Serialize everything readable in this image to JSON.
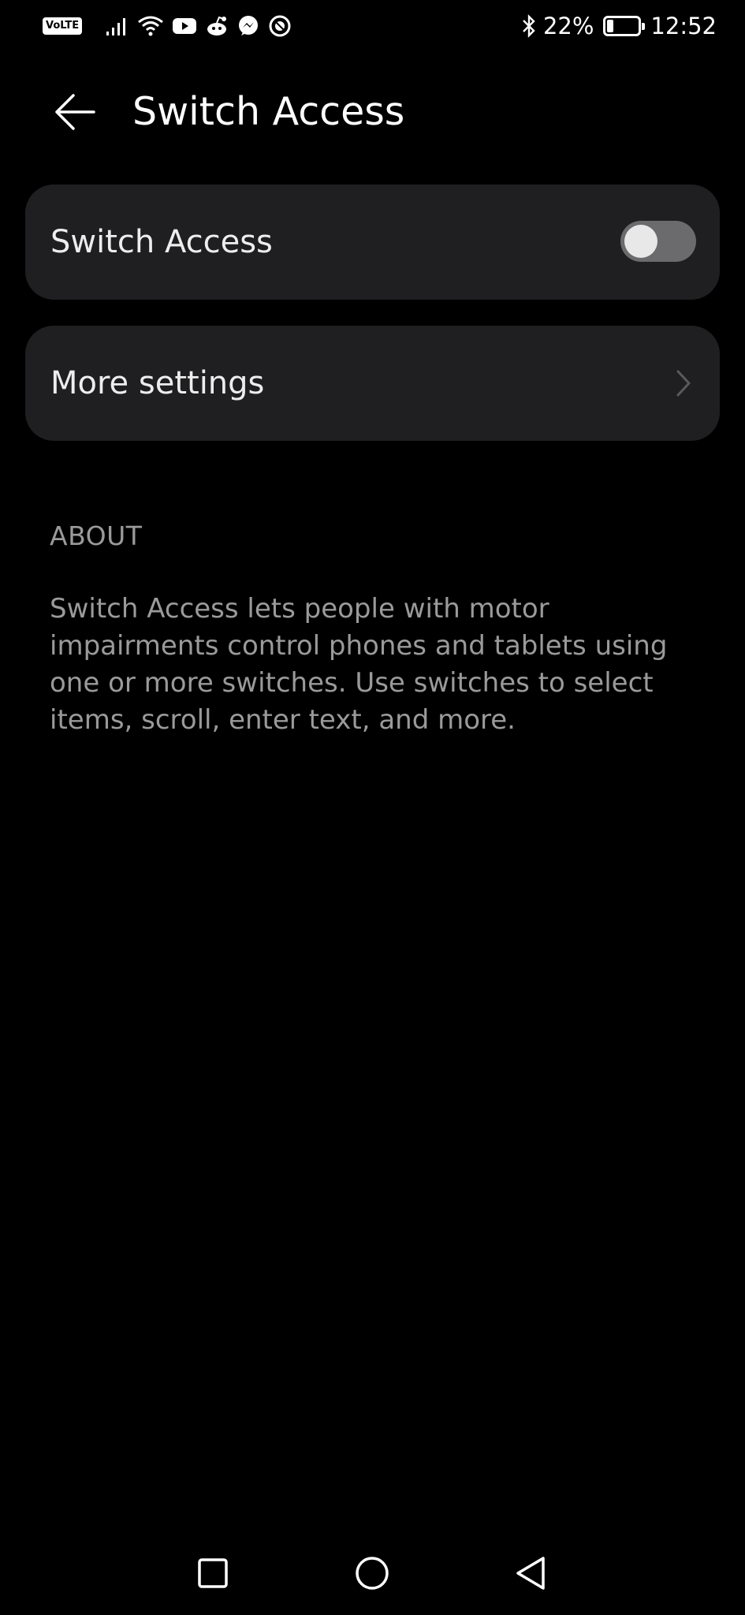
{
  "status_bar": {
    "volte": "VoLTE",
    "battery_percent": "22%",
    "battery_level": 0.22,
    "time": "12:52",
    "icons": [
      "signal-icon",
      "wifi-icon",
      "youtube-icon",
      "reddit-icon",
      "messenger-icon",
      "vpn-icon",
      "bluetooth-icon",
      "battery-icon"
    ]
  },
  "header": {
    "title": "Switch Access",
    "back_icon": "back-arrow-icon"
  },
  "settings": {
    "switch_access_label": "Switch Access",
    "switch_access_enabled": false,
    "more_settings_label": "More settings"
  },
  "about": {
    "header": "ABOUT",
    "text": "Switch Access lets people with motor impairments control phones and tablets using one or more switches. Use switches to select items, scroll, enter text, and more."
  },
  "nav": {
    "icons": [
      "recents-icon",
      "home-icon",
      "back-icon"
    ]
  },
  "colors": {
    "background": "#000000",
    "card": "#1f1f21",
    "secondary_text": "#9a9a9a",
    "toggle_off_track": "#6b6b6e"
  }
}
